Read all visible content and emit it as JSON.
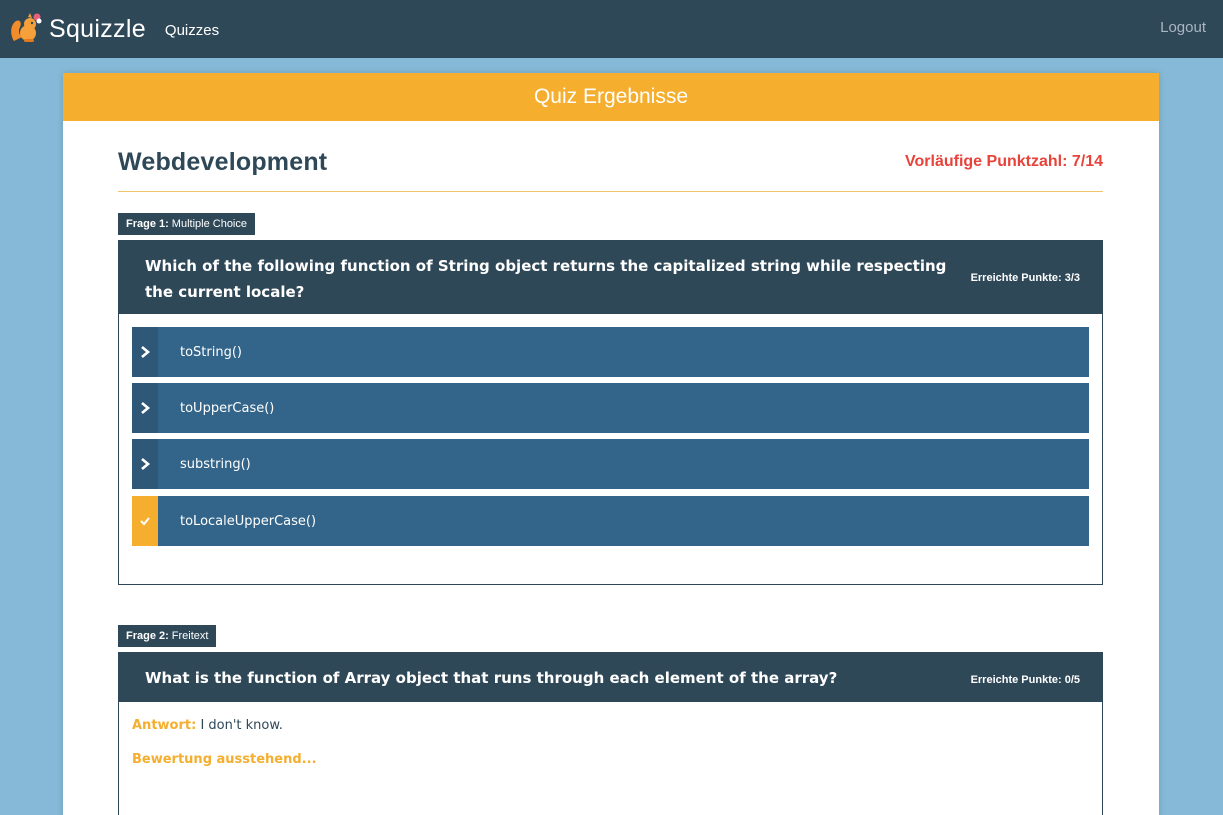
{
  "nav": {
    "brand": "Squizzle",
    "links": [
      "Quizzes"
    ],
    "logout": "Logout"
  },
  "card": {
    "header": "Quiz Ergebnisse",
    "quiz_title": "Webdevelopment",
    "score": "Vorläufige Punktzahl: 7/14"
  },
  "questions": [
    {
      "tag_label": "Frage 1:",
      "tag_type": "Multiple Choice",
      "text_line1": "Which of the following function of String object returns the capitalized string while respecting",
      "text_line2": "the current locale?",
      "points": "Erreichte Punkte: 3/3",
      "answers": [
        {
          "label": "toString()",
          "icon": "chevron-right-icon",
          "correct": false
        },
        {
          "label": "toUpperCase()",
          "icon": "chevron-right-icon",
          "correct": false
        },
        {
          "label": "substring()",
          "icon": "chevron-right-icon",
          "correct": false
        },
        {
          "label": "toLocaleUpperCase()",
          "icon": "check-icon",
          "correct": true
        }
      ]
    },
    {
      "tag_label": "Frage 2:",
      "tag_type": "Freitext",
      "text_line1": "What is the function of Array object that runs through each element of the array?",
      "points": "Erreichte Punkte: 0/5",
      "answer_label": "Antwort:",
      "answer_value": "I don't know.",
      "status": "Bewertung ausstehend..."
    }
  ],
  "colors": {
    "navbar": "#2f4858",
    "background": "#85b9d7",
    "accent": "#f5ae2e",
    "answer": "#33658a",
    "score": "#e8433b"
  }
}
